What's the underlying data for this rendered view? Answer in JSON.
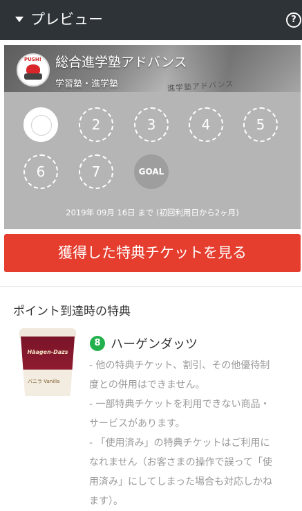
{
  "header": {
    "title": "プレビュー",
    "help_icon": "?"
  },
  "shop": {
    "name": "総合進学塾アドバンス",
    "category": "学習塾・進学塾",
    "photo_sign": "進学塾アドバンス",
    "logo_text": "PUSH!"
  },
  "stamps": {
    "labels": [
      "",
      "2",
      "3",
      "4",
      "5",
      "6",
      "7",
      "GOAL"
    ],
    "expiry": "2019年 09月 16日 まで (初回利用日から2ヶ月)"
  },
  "ticket_button": {
    "label": "獲得した特典チケットを見る"
  },
  "rewards": {
    "section_title": "ポイント到達時の特典",
    "item": {
      "points": "8",
      "name": "ハーゲンダッツ",
      "image_brand": "Häagen-Dazs",
      "image_label": "バニラ Vanilla",
      "notes": [
        "- 他の特典チケット、割引、その他優待制",
        "度との併用はできません。",
        "- 一部特典チケットを利用できない商品・",
        "サービスがあります。",
        "- 「使用済み」の特典チケットはご利用に",
        "なれません（お客さまの操作で誤って「使",
        "用済み」にしてしまった場合も対応しかね",
        "ます）。"
      ]
    }
  },
  "colors": {
    "header_bg": "#2e3338",
    "button_red": "#e53d2e",
    "card_gray": "#b5b5b5",
    "badge_green": "#22b14c"
  }
}
